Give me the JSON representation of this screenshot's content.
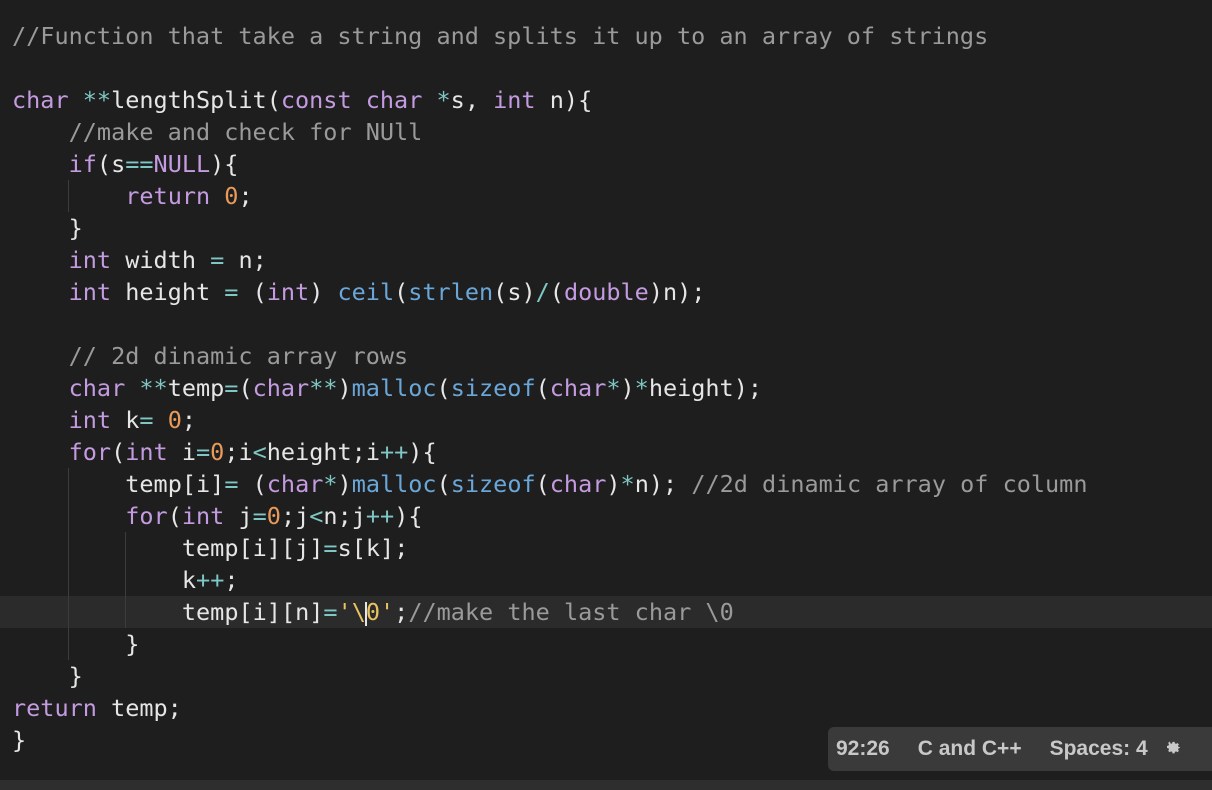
{
  "editor": {
    "lines": [
      "//Function that take a string and splits it up to an array of strings",
      "",
      "char **lengthSplit(const char *s, int n){",
      "    //make and check for NUll",
      "    if(s==NULL){",
      "        return 0;",
      "    }",
      "    int width = n;",
      "    int height = (int) ceil(strlen(s)/(double)n);",
      "",
      "    // 2d dinamic array rows",
      "    char **temp=(char**)malloc(sizeof(char*)*height);",
      "    int k= 0;",
      "    for(int i=0;i<height;i++){",
      "        temp[i]= (char*)malloc(sizeof(char)*n); //2d dinamic array of column",
      "        for(int j=0;j<n;j++){",
      "            temp[i][j]=s[k];",
      "            k++;",
      "            temp[i][n]='\\0';//make the last char \\0",
      "        }",
      "    }",
      "return temp;",
      "}"
    ],
    "current_line_index": 18
  },
  "statusbar": {
    "cursor_position": "92:26",
    "language": "C and C++",
    "indentation": "Spaces: 4",
    "settings_icon": "gear-icon"
  },
  "colors": {
    "background": "#1e1e1e",
    "keyword": "#c49be0",
    "function": "#6aa7d8",
    "comment": "#9a9a9a",
    "number": "#e89a5a",
    "string": "#e8c35f",
    "operator": "#7fc7c4",
    "text": "#e6e6e6"
  }
}
